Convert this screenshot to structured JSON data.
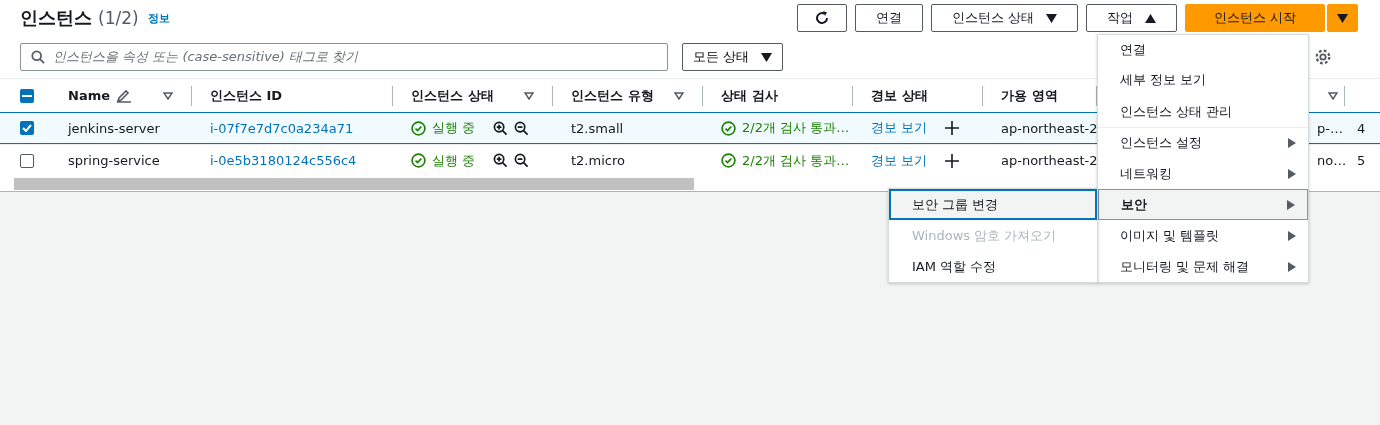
{
  "header": {
    "title": "인스턴스",
    "count": "(1/2)",
    "info_link": "정보"
  },
  "toolbar": {
    "buttons": [
      {
        "kind": "refresh"
      },
      {
        "kind": "text",
        "label": "연결"
      },
      {
        "kind": "dropdown",
        "label": "인스턴스 상태",
        "expanded": false
      },
      {
        "kind": "dropdown",
        "label": "작업",
        "expanded": true
      },
      {
        "kind": "primary",
        "label": "인스턴스 시작"
      },
      {
        "kind": "primary-caret"
      }
    ]
  },
  "search": {
    "placeholder": "인스턴스을 속성 또는 (case-sensitive) 태그로 찾기"
  },
  "state_filter": {
    "label": "모든 상태"
  },
  "table": {
    "select_all_partial": true,
    "columns": [
      {
        "label": "Name",
        "editable": true,
        "filter": true
      },
      {
        "label": "인스턴스 ID",
        "filter": false
      },
      {
        "label": "인스턴스 상태",
        "filter": true
      },
      {
        "label": "인스턴스 유형",
        "filter": true
      },
      {
        "label": "상태 검사",
        "filter": false
      },
      {
        "label": "경보 상태",
        "filter": false
      },
      {
        "label": "가용 영역",
        "filter": false
      },
      {
        "filter": true
      }
    ],
    "rows": [
      {
        "selected": true,
        "name": "jenkins-server",
        "id": "i-07f7e7d7c0a234a71",
        "state": "실행 중",
        "type": "t2.small",
        "checks": "2/2개 검사 통과…",
        "alarm": "경보 보기",
        "zone": "ap-northeast-2",
        "column_8": "p-…",
        "column_9": "4"
      },
      {
        "selected": false,
        "name": "spring-service",
        "id": "i-0e5b3180124c556c4",
        "state": "실행 중",
        "type": "t2.micro",
        "checks": "2/2개 검사 통과…",
        "alarm": "경보 보기",
        "zone": "ap-northeast-2",
        "column_8": "no…",
        "column_9": "5"
      }
    ]
  },
  "actions_menu": {
    "items": [
      {
        "label": "연결",
        "kind": "item",
        "selected": false
      },
      {
        "label": "세부 정보 보기",
        "kind": "item",
        "selected": false
      },
      {
        "label": "인스턴스 상태 관리",
        "kind": "item",
        "selected": false
      },
      {
        "label": "인스턴스 설정",
        "kind": "submenu",
        "selected": false
      },
      {
        "label": "네트워킹",
        "kind": "submenu",
        "selected": false
      },
      {
        "label": "보안",
        "kind": "submenu",
        "selected": true,
        "children": [
          {
            "label": "보안 그룹 변경",
            "focused": true,
            "disabled": false
          },
          {
            "label": "Windows 암호 가져오기",
            "focused": false,
            "disabled": true
          },
          {
            "label": "IAM 역할 수정",
            "focused": false,
            "disabled": false
          }
        ]
      },
      {
        "label": "이미지 및 템플릿",
        "kind": "submenu",
        "selected": false
      },
      {
        "label": "모니터링 및 문제 해결",
        "kind": "submenu",
        "selected": false
      }
    ]
  }
}
